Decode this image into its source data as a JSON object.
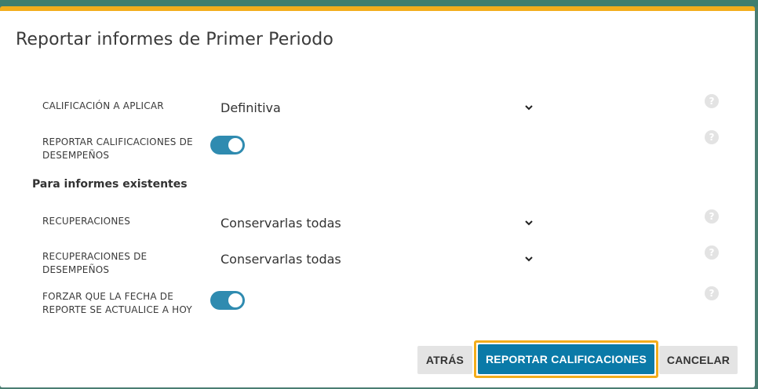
{
  "dialog": {
    "title": "Reportar informes de Primer Periodo"
  },
  "fields": {
    "calificacion": {
      "label": "CALIFICACIÓN A APLICAR",
      "value": "Definitiva"
    },
    "reportar_desempenos": {
      "label_line1": "REPORTAR CALIFICACIONES DE",
      "label_line2": "DESEMPEÑOS",
      "enabled": true
    },
    "section_title": "Para informes existentes",
    "recuperaciones": {
      "label": "RECUPERACIONES",
      "value": "Conservarlas todas"
    },
    "recuperaciones_desempenos": {
      "label_line1": "RECUPERACIONES DE",
      "label_line2": "DESEMPEÑOS",
      "value": "Conservarlas todas"
    },
    "forzar_fecha": {
      "label_line1": "FORZAR QUE LA FECHA DE",
      "label_line2": "REPORTE SE ACTUALICE A HOY",
      "enabled": true
    }
  },
  "help_icon_glyph": "?",
  "buttons": {
    "back": "ATRÁS",
    "report": "REPORTAR CALIFICACIONES",
    "cancel": "CANCELAR"
  },
  "colors": {
    "accent": "#f2ad1c",
    "primary": "#0a7aa8",
    "toggle_on": "#2f8bb0"
  }
}
